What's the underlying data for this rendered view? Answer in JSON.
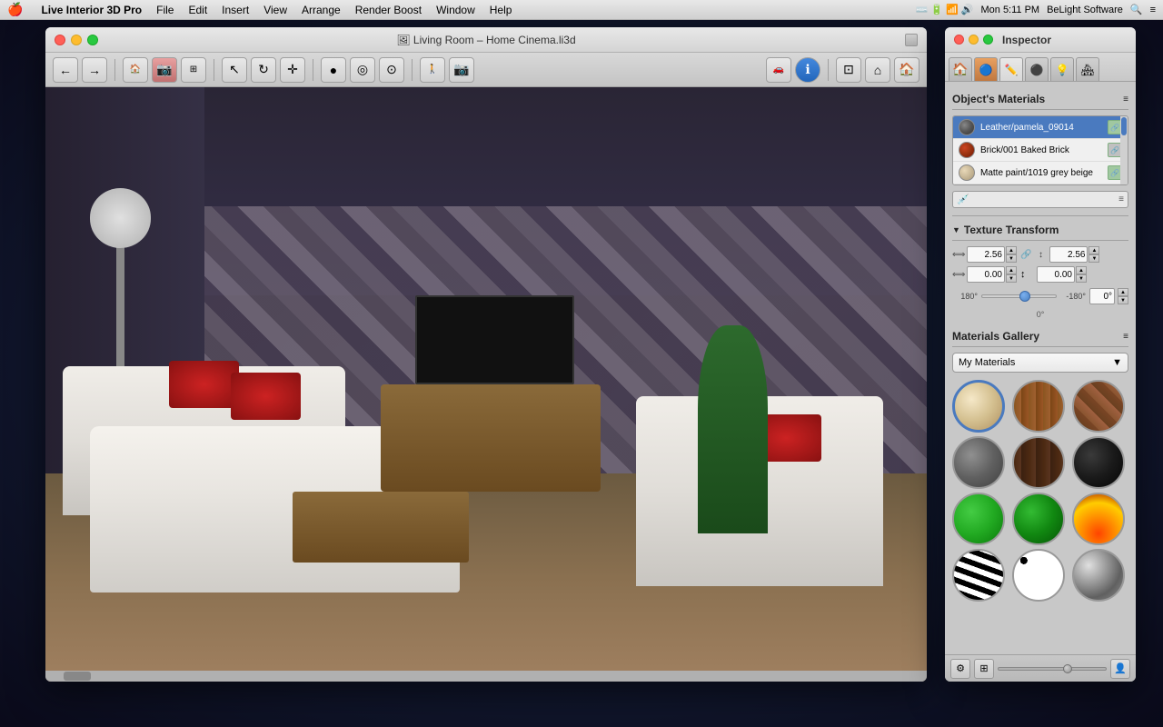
{
  "menubar": {
    "apple": "🍎",
    "app_name": "Live Interior 3D Pro",
    "menus": [
      "File",
      "Edit",
      "Insert",
      "View",
      "Arrange",
      "Render Boost",
      "Window",
      "Help"
    ],
    "right": {
      "time": "Mon 5:11 PM",
      "company": "BeLight Software"
    }
  },
  "window": {
    "title": "🖼 Living Room – Home Cinema.li3d",
    "traffic_lights": [
      "close",
      "minimize",
      "maximize"
    ]
  },
  "inspector": {
    "title": "Inspector",
    "tabs": [
      "🏠",
      "🔵",
      "✏️",
      "⚫",
      "💡",
      "🏠"
    ],
    "objects_materials_label": "Object's Materials",
    "materials": [
      {
        "name": "Leather/pamela_09014",
        "color": "#666",
        "type": "leather"
      },
      {
        "name": "Brick/001 Baked Brick",
        "color": "#cc4422",
        "type": "brick"
      },
      {
        "name": "Matte paint/1019 grey beige",
        "color": "#d4c8a8",
        "type": "matte"
      }
    ],
    "texture_transform": {
      "label": "Texture Transform",
      "w1": "2.56",
      "h1": "2.56",
      "w2": "0.00",
      "h2": "0.00",
      "angle": "0°",
      "slider_left": "180°",
      "slider_center": "0°",
      "slider_right": "-180°"
    },
    "materials_gallery": {
      "label": "Materials Gallery",
      "dropdown": "My Materials",
      "items": [
        {
          "id": "cream",
          "type": "cream",
          "selected": true
        },
        {
          "id": "wood",
          "type": "wood"
        },
        {
          "id": "brown-tile",
          "type": "brown-tile"
        },
        {
          "id": "metal",
          "type": "metal"
        },
        {
          "id": "dark-wood",
          "type": "dark-wood"
        },
        {
          "id": "black",
          "type": "black"
        },
        {
          "id": "green",
          "type": "green"
        },
        {
          "id": "green2",
          "type": "green2"
        },
        {
          "id": "fire",
          "type": "fire"
        },
        {
          "id": "zebra",
          "type": "zebra"
        },
        {
          "id": "spots",
          "type": "spots"
        },
        {
          "id": "chrome",
          "type": "chrome"
        }
      ]
    }
  },
  "toolbar": {
    "buttons": [
      "nav-back",
      "nav-forward",
      "floor-plan-2d",
      "render-photo",
      "floor-plan-3d",
      "cursor",
      "rotate",
      "move",
      "sphere",
      "disk",
      "cylinder",
      "walk",
      "camera",
      "view-ortho",
      "view-house",
      "view-3d",
      "3d-object",
      "info"
    ]
  }
}
